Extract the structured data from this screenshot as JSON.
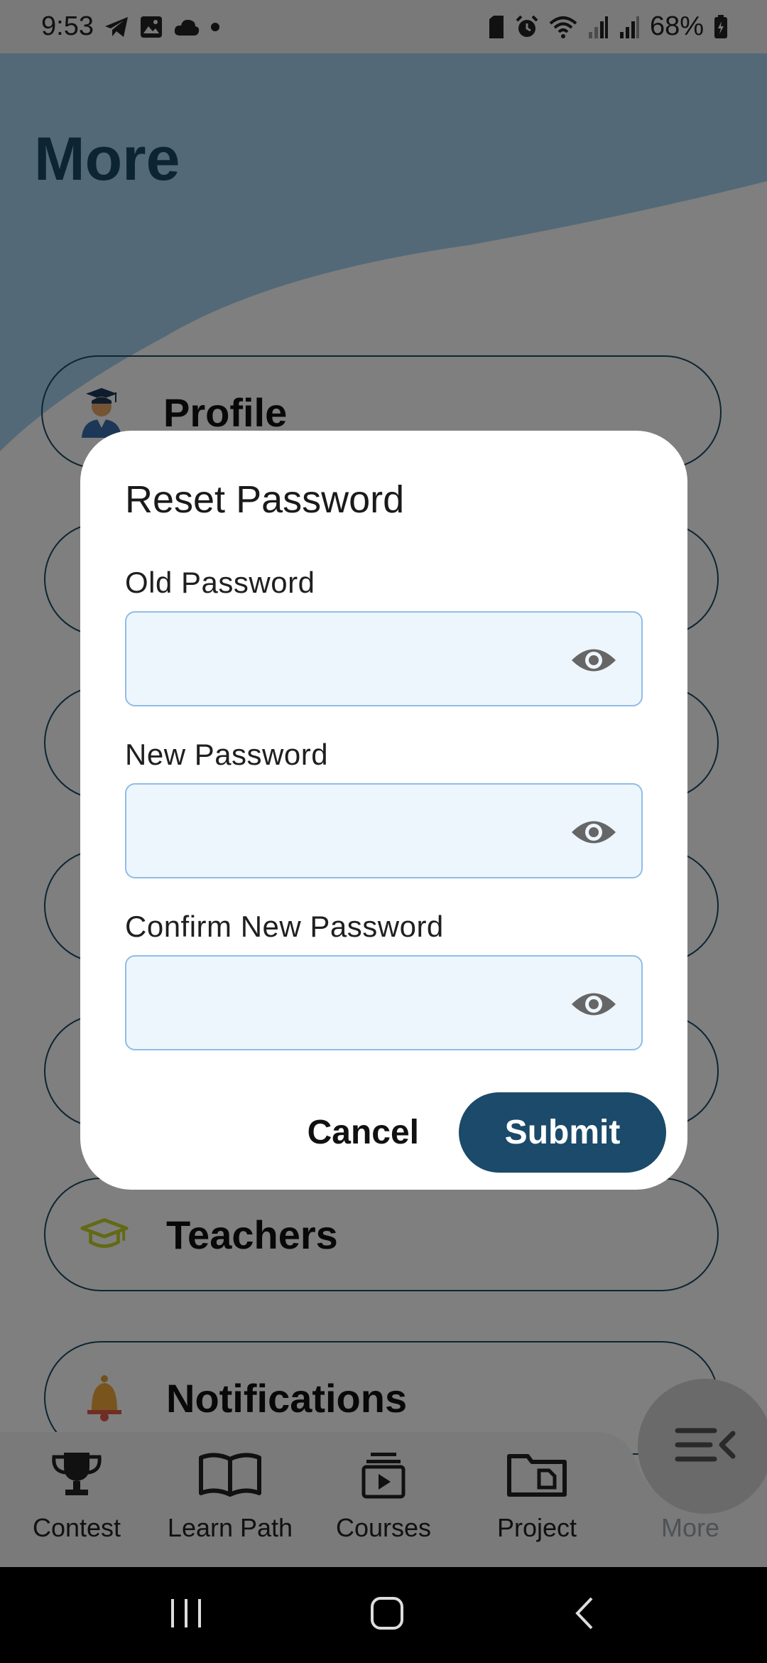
{
  "status_bar": {
    "time": "9:53",
    "battery": "68%",
    "left_icons": [
      "telegram-icon",
      "gallery-icon",
      "cloud-icon",
      "dot-icon"
    ],
    "right_icons": [
      "sim-icon",
      "alarm-icon",
      "wifi-icon",
      "signal-icon",
      "signal-icon",
      "battery-icon"
    ]
  },
  "page": {
    "title": "More",
    "menu_items": [
      {
        "label": "Profile",
        "icon": "graduate-avatar-icon"
      },
      {
        "label": "",
        "icon": ""
      },
      {
        "label": "",
        "icon": ""
      },
      {
        "label": "",
        "icon": ""
      },
      {
        "label": "",
        "icon": ""
      },
      {
        "label": "Teachers",
        "icon": "mortarboard-icon"
      },
      {
        "label": "Notifications",
        "icon": "bell-icon"
      }
    ]
  },
  "bottom_nav": {
    "items": [
      {
        "label": "Contest",
        "icon": "trophy-icon"
      },
      {
        "label": "Learn Path",
        "icon": "book-icon"
      },
      {
        "label": "Courses",
        "icon": "video-stack-icon"
      },
      {
        "label": "Project",
        "icon": "folder-icon"
      },
      {
        "label": "More",
        "icon": "menu-collapse-icon",
        "active": true
      }
    ]
  },
  "dialog": {
    "title": "Reset Password",
    "fields": [
      {
        "label": "Old Password",
        "value": ""
      },
      {
        "label": "New Password",
        "value": ""
      },
      {
        "label": "Confirm New Password",
        "value": ""
      }
    ],
    "cancel_label": "Cancel",
    "submit_label": "Submit"
  },
  "colors": {
    "brand": "#1b4a6a",
    "field_bg": "#eef6fd",
    "field_border": "#8fbde6",
    "wave": "#a8d3ee"
  }
}
